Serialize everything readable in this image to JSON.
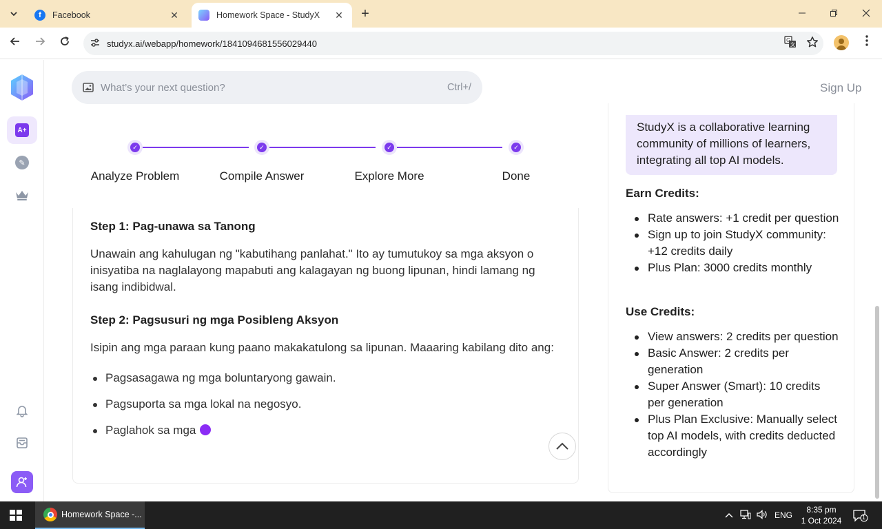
{
  "browser": {
    "tabs": [
      {
        "title": "Facebook",
        "active": false
      },
      {
        "title": "Homework Space - StudyX",
        "active": true
      }
    ],
    "url": "studyx.ai/webapp/homework/1841094681556029440"
  },
  "search": {
    "placeholder": "What’s your next question?",
    "shortcut": "Ctrl+/"
  },
  "header": {
    "signup_label": "Sign Up"
  },
  "progress": {
    "steps": [
      "Analyze Problem",
      "Compile Answer",
      "Explore More",
      "Done"
    ]
  },
  "answer": {
    "step1_heading": "Step 1: Pag-unawa sa Tanong",
    "step1_text": "Unawain ang kahulugan ng \"kabutihang panlahat.\" Ito ay tumutukoy sa mga aksyon o inisyatiba na naglalayong mapabuti ang kalagayan ng buong lipunan, hindi lamang ng isang indibidwal.",
    "step2_heading": "Step 2: Pagsusuri ng mga Posibleng Aksyon",
    "step2_text": "Isipin ang mga paraan kung paano makakatulong sa lipunan. Maaaring kabilang dito ang:",
    "bullets": [
      "Pagsasagawa ng mga boluntaryong gawain.",
      "Pagsuporta sa mga lokal na negosyo.",
      "Paglahok sa mga"
    ]
  },
  "credits": {
    "intro": "StudyX is a collaborative learning community of millions of learners, integrating all top AI models.",
    "earn_heading": "Earn Credits:",
    "earn_items": [
      "Rate answers: +1 credit per question",
      "Sign up to join StudyX community: +12 credits daily",
      "Plus Plan: 3000 credits monthly"
    ],
    "use_heading": "Use Credits:",
    "use_items": [
      "View answers: 2 credits per question",
      "Basic Answer: 2 credits per generation",
      "Super Answer (Smart): 10 credits per generation",
      "Plus Plan Exclusive: Manually select top AI models, with credits deducted accordingly"
    ]
  },
  "taskbar": {
    "app_label": "Homework Space -...",
    "lang": "ENG",
    "time": "8:35 pm",
    "date": "1 Oct 2024",
    "notif_count": "1"
  },
  "colors": {
    "accent": "#7c3aed",
    "tabstrip": "#f8e7c4",
    "intro_bg": "#ede7fc"
  }
}
